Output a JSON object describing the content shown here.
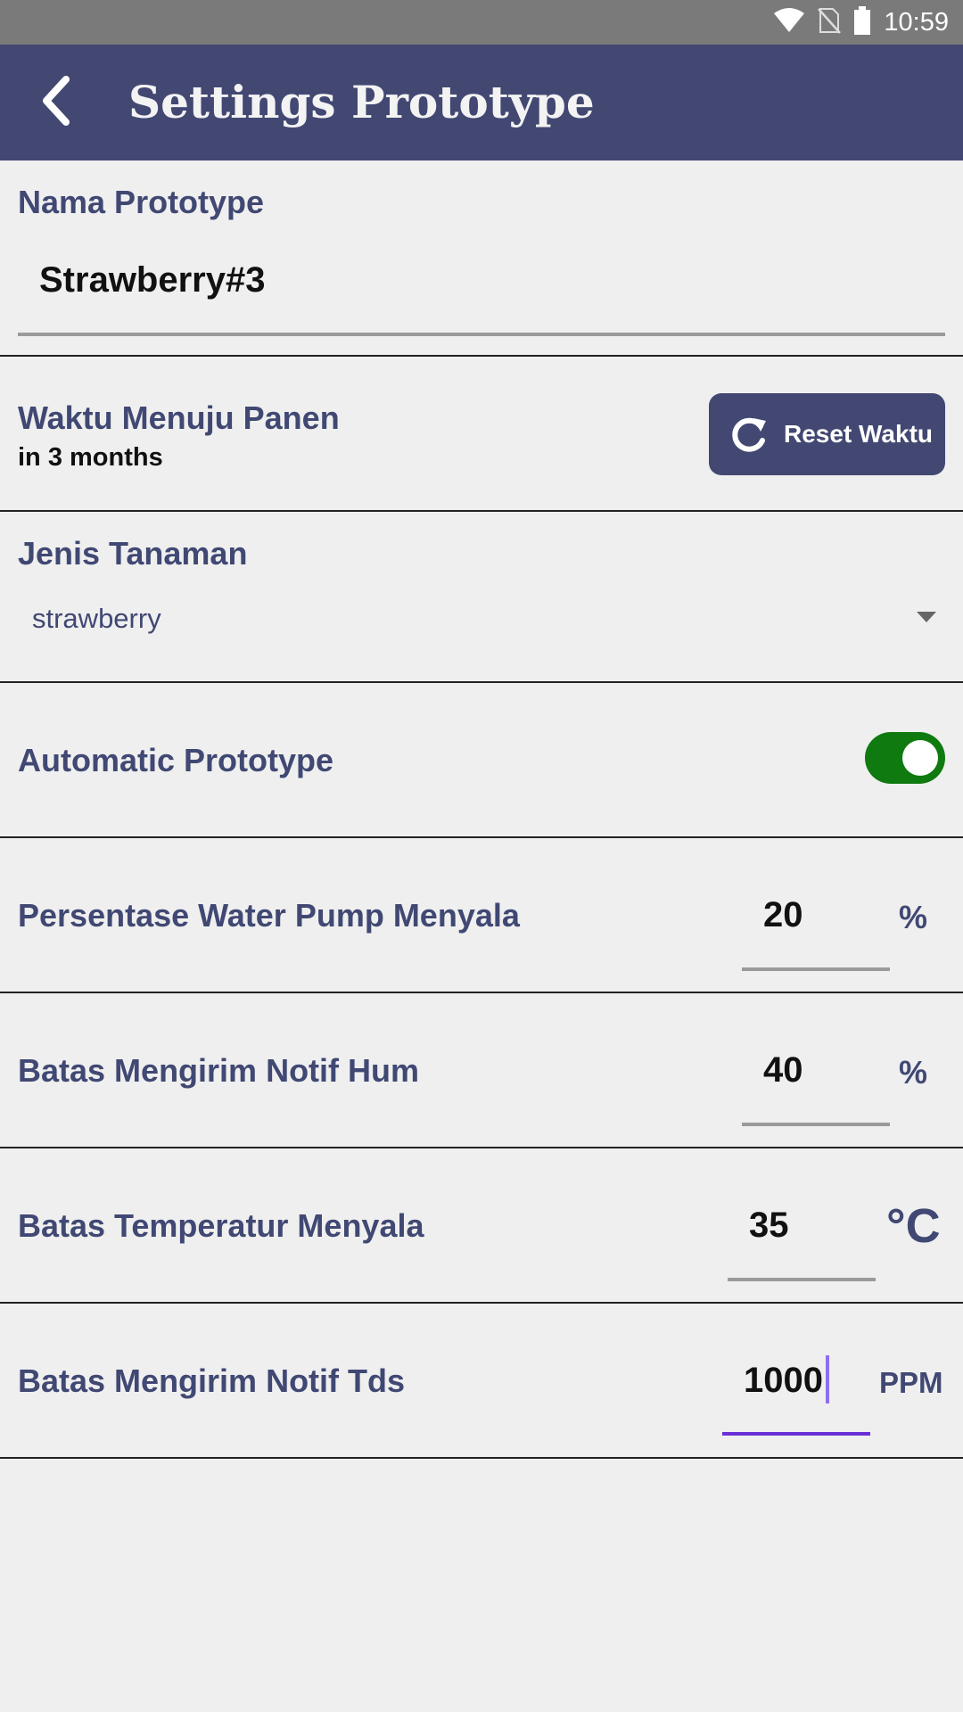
{
  "status_bar": {
    "time": "10:59",
    "icons": [
      "wifi-icon",
      "no-sim-icon",
      "battery-icon"
    ]
  },
  "app_bar": {
    "title": "Settings Prototype",
    "back_icon": "chevron-left-icon"
  },
  "nama_prototype": {
    "label": "Nama Prototype",
    "value": "Strawberry#3"
  },
  "waktu_panen": {
    "label": "Waktu Menuju Panen",
    "value": "in 3 months",
    "button_label": "Reset Waktu",
    "button_icon": "refresh-icon"
  },
  "jenis_tanaman": {
    "label": "Jenis Tanaman",
    "selected": "strawberry",
    "dropdown_icon": "caret-down-icon"
  },
  "automatic": {
    "label": "Automatic Prototype",
    "enabled": true
  },
  "water_pump": {
    "label": "Persentase Water Pump Menyala",
    "value": "20",
    "unit": "%"
  },
  "notif_hum": {
    "label": "Batas Mengirim Notif Hum",
    "value": "40",
    "unit": "%"
  },
  "temperatur": {
    "label": "Batas Temperatur Menyala",
    "value": "35",
    "unit": "°C"
  },
  "notif_tds": {
    "label": "Batas Mengirim Notif Tds",
    "value": "1000",
    "unit": "PPM"
  },
  "colors": {
    "primary": "#424872",
    "label": "#404873",
    "toggle_on": "#0f7a10",
    "focus": "#6a2fd6",
    "background": "#efefef"
  }
}
